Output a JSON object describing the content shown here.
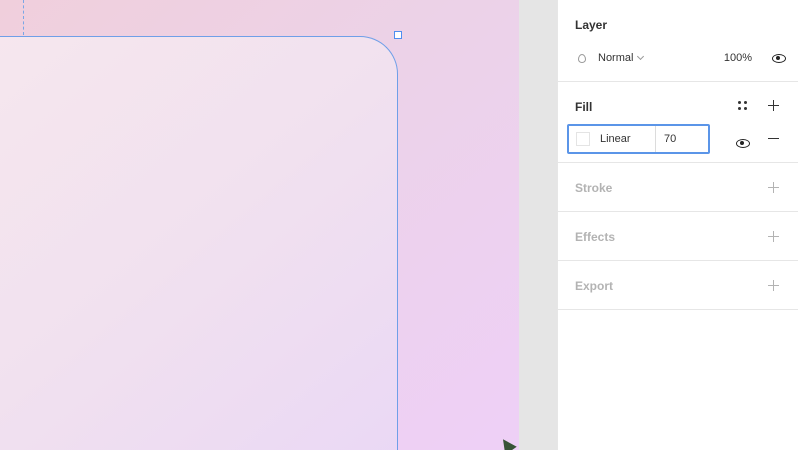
{
  "panel": {
    "layer": {
      "title": "Layer",
      "blend_mode": "Normal",
      "opacity": "100%"
    },
    "fill": {
      "title": "Fill",
      "type": "Linear",
      "opacity": "70",
      "swatch_color": "#ffffff"
    },
    "stroke": {
      "title": "Stroke"
    },
    "effects": {
      "title": "Effects"
    },
    "export": {
      "title": "Export"
    }
  },
  "colors": {
    "selection": "#5b95e8",
    "canvas_gradient": [
      "#f0cfdc",
      "#eed0f7"
    ]
  }
}
